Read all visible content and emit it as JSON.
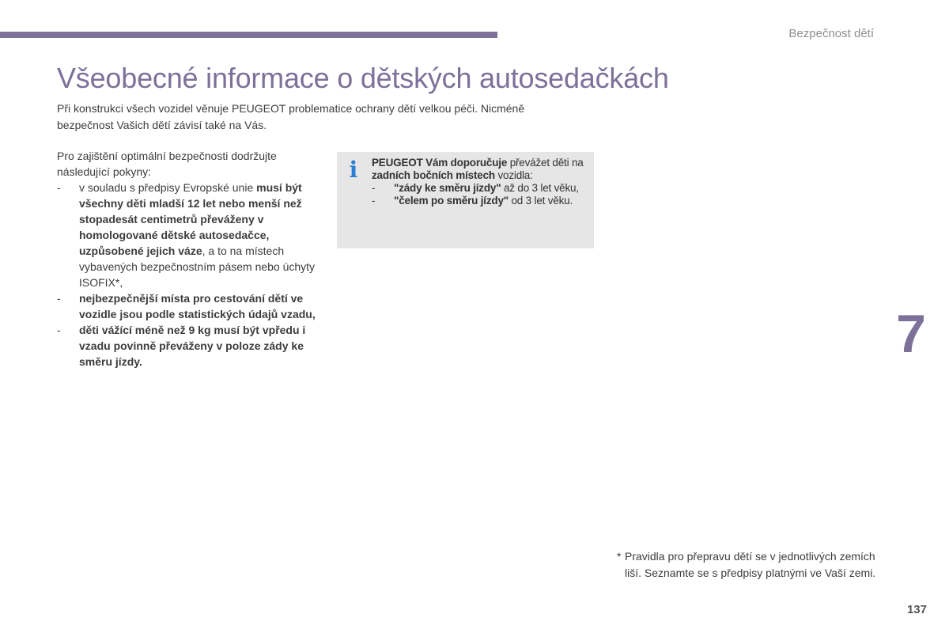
{
  "header": {
    "section_title": "Bezpečnost dětí",
    "accent_color": "#7d7199"
  },
  "title": "Všeobecné informace o dětských autosedačkách",
  "intro": [
    "Při konstrukci všech vozidel věnuje PEUGEOT problematice ochrany dětí velkou péči. Nicméně",
    "bezpečnost Vašich dětí závisí také na Vás."
  ],
  "guidelines": {
    "lead": "Pro zajištění optimální bezpečnosti dodržujte následující pokyny:",
    "items": [
      {
        "pre": "v souladu s předpisy Evropské unie ",
        "bold": "musí být všechny děti mladší 12 let nebo menší než stopadesát centimetrů převáženy v homologované dětské autosedačce, uzpůsobené jejich váze",
        "post": ", a to na místech vybavených bezpečnostním pásem nebo úchyty ISOFIX*,"
      },
      {
        "pre": "",
        "bold": "nejbezpečnější místa pro cestování dětí ve vozidle jsou podle statistických údajů vzadu,",
        "post": ""
      },
      {
        "pre": "",
        "bold": "děti vážící méně než 9 kg musí být vpředu i vzadu povinně převáženy v poloze zády ke směru jízdy.",
        "post": ""
      }
    ]
  },
  "info_box": {
    "icon": "info-icon",
    "icon_glyph": "i",
    "icon_color": "#2a7fd4",
    "bold1": "PEUGEOT Vám doporučuje",
    "text1": " převážet děti na ",
    "bold2": "zadních bočních místech",
    "text2": " vozidla:",
    "items": [
      {
        "bold": "\"zády ke směru jízdy\"",
        "text": " až do 3 let věku,"
      },
      {
        "bold": "\"čelem po směru jízdy\"",
        "text": " od 3 let věku."
      }
    ]
  },
  "chapter_number": "7",
  "footnote": {
    "marker": "*",
    "text": "Pravidla pro přepravu dětí se v jednotlivých zemích liší. Seznamte se s předpisy platnými ve Vaší zemi."
  },
  "page_number": "137"
}
